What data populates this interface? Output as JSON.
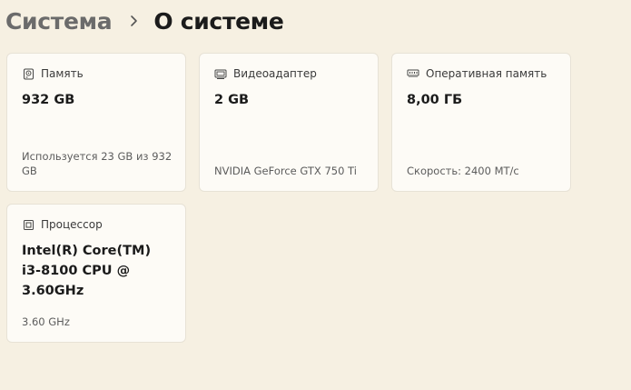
{
  "breadcrumb": {
    "parent": "Система",
    "current": "О системе"
  },
  "cards": {
    "storage": {
      "label": "Память",
      "icon": "hard-drive-icon",
      "value": "932 GB",
      "detail": "Используется 23 GB из 932 GB"
    },
    "gpu": {
      "label": "Видеоадаптер",
      "icon": "display-adapter-icon",
      "value": "2 GB",
      "detail": "NVIDIA GeForce GTX 750 Ti"
    },
    "ram": {
      "label": "Оперативная память",
      "icon": "memory-module-icon",
      "value": "8,00 ГБ",
      "detail": "Скорость: 2400 МТ/с"
    },
    "cpu": {
      "label": "Процессор",
      "icon": "processor-icon",
      "value": "Intel(R) Core(TM) i3-8100 CPU @ 3.60GHz",
      "detail": "3.60 GHz"
    }
  },
  "colors": {
    "background": "#f6f0e2",
    "card": "#fdfbf6",
    "card_border": "#e7e2d6"
  }
}
